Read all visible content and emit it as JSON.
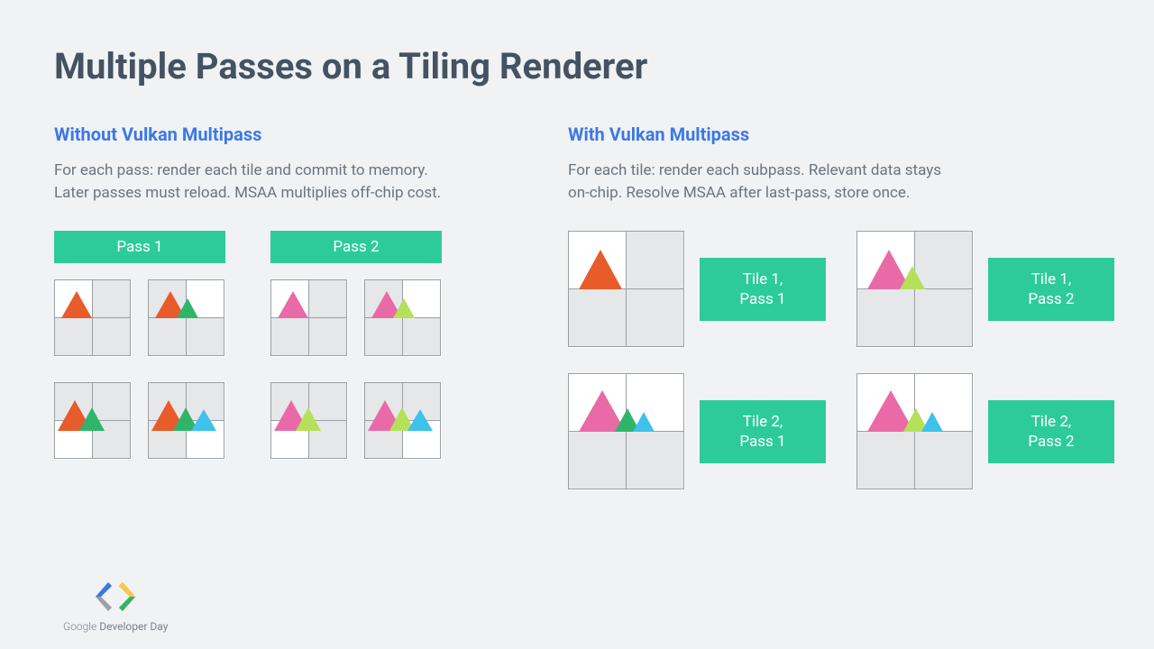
{
  "title": "Multiple Passes on a Tiling Renderer",
  "left": {
    "heading": "Without Vulkan Multipass",
    "body": "For each pass: render each tile and commit to memory. Later passes must reload. MSAA multiplies off-chip cost.",
    "pass1": "Pass 1",
    "pass2": "Pass 2"
  },
  "right": {
    "heading": "With Vulkan Multipass",
    "body": "For each tile: render each subpass. Relevant data stays on-chip. Resolve MSAA after last-pass, store once.",
    "labels": {
      "t1p1": "Tile 1,\nPass 1",
      "t1p2": "Tile 1,\nPass 2",
      "t2p1": "Tile 2,\nPass 1",
      "t2p2": "Tile 2,\nPass 2"
    }
  },
  "footer": {
    "brand_light": "Google",
    "brand_rest": " Developer Day"
  },
  "colors": {
    "accent": "#2ecb9a",
    "blue": "#3b78e7",
    "orange": "#e85b2a",
    "green": "#2fb56a",
    "pink": "#e96aa6",
    "lime": "#b5e05a",
    "cyan": "#3ec1ea"
  }
}
